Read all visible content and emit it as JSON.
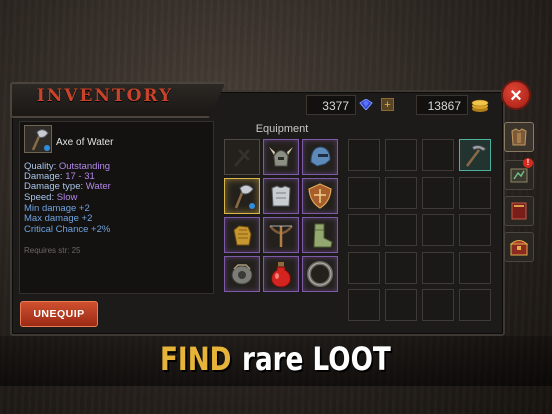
{
  "window": {
    "title": "INVENTORY",
    "close_label": "×"
  },
  "currency": {
    "gems": "3377",
    "gems_icon": "blue-gem-icon",
    "add_label": "+",
    "gold": "13867",
    "gold_icon": "gold-coins-icon"
  },
  "side_tabs": [
    {
      "name": "character",
      "icon": "armor-icon",
      "active": true
    },
    {
      "name": "quests",
      "icon": "map-icon",
      "alert": "!"
    },
    {
      "name": "spellbook",
      "icon": "book-icon"
    },
    {
      "name": "shop",
      "icon": "chest-icon"
    }
  ],
  "item": {
    "name": "Axe of Water",
    "icon": "axe-icon",
    "quality_label": "Quality:",
    "quality": "Outstanding",
    "damage_label": "Damage:",
    "damage": "17 - 31",
    "damage_type_label": "Damage type:",
    "damage_type": "Water",
    "speed_label": "Speed:",
    "speed": "Slow",
    "bonuses": [
      "Min damage +2",
      "Max damage +2",
      "Critical Chance +2%"
    ],
    "requirement": "Requires str: 25"
  },
  "unequip_label": "UNEQUIP",
  "equipment": {
    "label": "Equipment",
    "slots": [
      {
        "icon": "empty-slot-icon"
      },
      {
        "icon": "horned-helmet-icon"
      },
      {
        "icon": "blue-helmet-icon"
      },
      {
        "icon": "axe-icon",
        "selected": true
      },
      {
        "icon": "chest-armor-icon"
      },
      {
        "icon": "shield-icon"
      },
      {
        "icon": "gauntlet-icon"
      },
      {
        "icon": "crossbow-icon"
      },
      {
        "icon": "boots-icon"
      },
      {
        "icon": "bracer-icon"
      },
      {
        "icon": "red-potion-icon"
      },
      {
        "icon": "ring-icon"
      }
    ]
  },
  "inventory": {
    "filled": [
      {
        "index": 3,
        "icon": "pickaxe-icon"
      }
    ],
    "total_slots": 20
  },
  "banner": {
    "highlight": "FIND",
    "text": "rare LOOT"
  }
}
